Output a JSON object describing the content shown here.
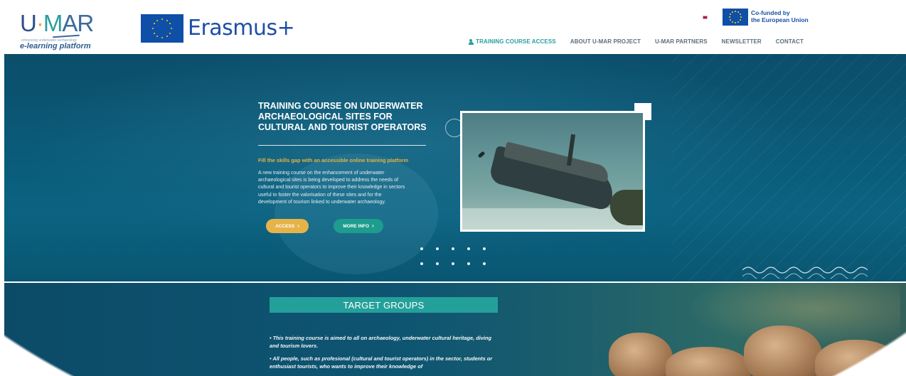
{
  "header": {
    "logo_text": "U·MAR",
    "logo_tagline": "enhancing underwater archaeology",
    "logo_sub": "e-learning platform",
    "erasmus_text": "Erasmus+",
    "cofunded_line1": "Co-funded by",
    "cofunded_line2": "the European Union"
  },
  "nav": {
    "items": [
      {
        "label": "TRAINING COURSE ACCESS",
        "active": true
      },
      {
        "label": "ABOUT U-MAR PROJECT"
      },
      {
        "label": "U-MAR PARTNERS"
      },
      {
        "label": "NEWSLETTER"
      },
      {
        "label": "CONTACT"
      }
    ]
  },
  "hero": {
    "title": "TRAINING COURSE ON UNDERWATER ARCHAEOLOGICAL SITES FOR CULTURAL AND TOURIST OPERATORS",
    "tagline": "Fill the skills gap with an accessible online training platform",
    "description": "A new training course on the enhancement of underwater archaeological sites is being developed to address the needs of cultural and tourist operators to improve their knowledge in sectors useful to foster the valorisation of these sites and for the development of tourism linked to underwater archaeology.",
    "access_label": "ACCESS",
    "more_label": "MORE INFO",
    "slider_dots": 10
  },
  "target": {
    "title": "TARGET GROUPS",
    "items": [
      "• This training course is aimed to all on archaeology, underwater cultural heritage, diving and tourism lovers.",
      "• All people, such as profesional (cultural and tourist operators) in the sector, students or enthusiast tourists, who wants to improve their knowledge of"
    ]
  },
  "colors": {
    "accent_teal": "#2a9ea0",
    "accent_gold": "#e6b349",
    "brand_blue": "#1d4fa6"
  }
}
